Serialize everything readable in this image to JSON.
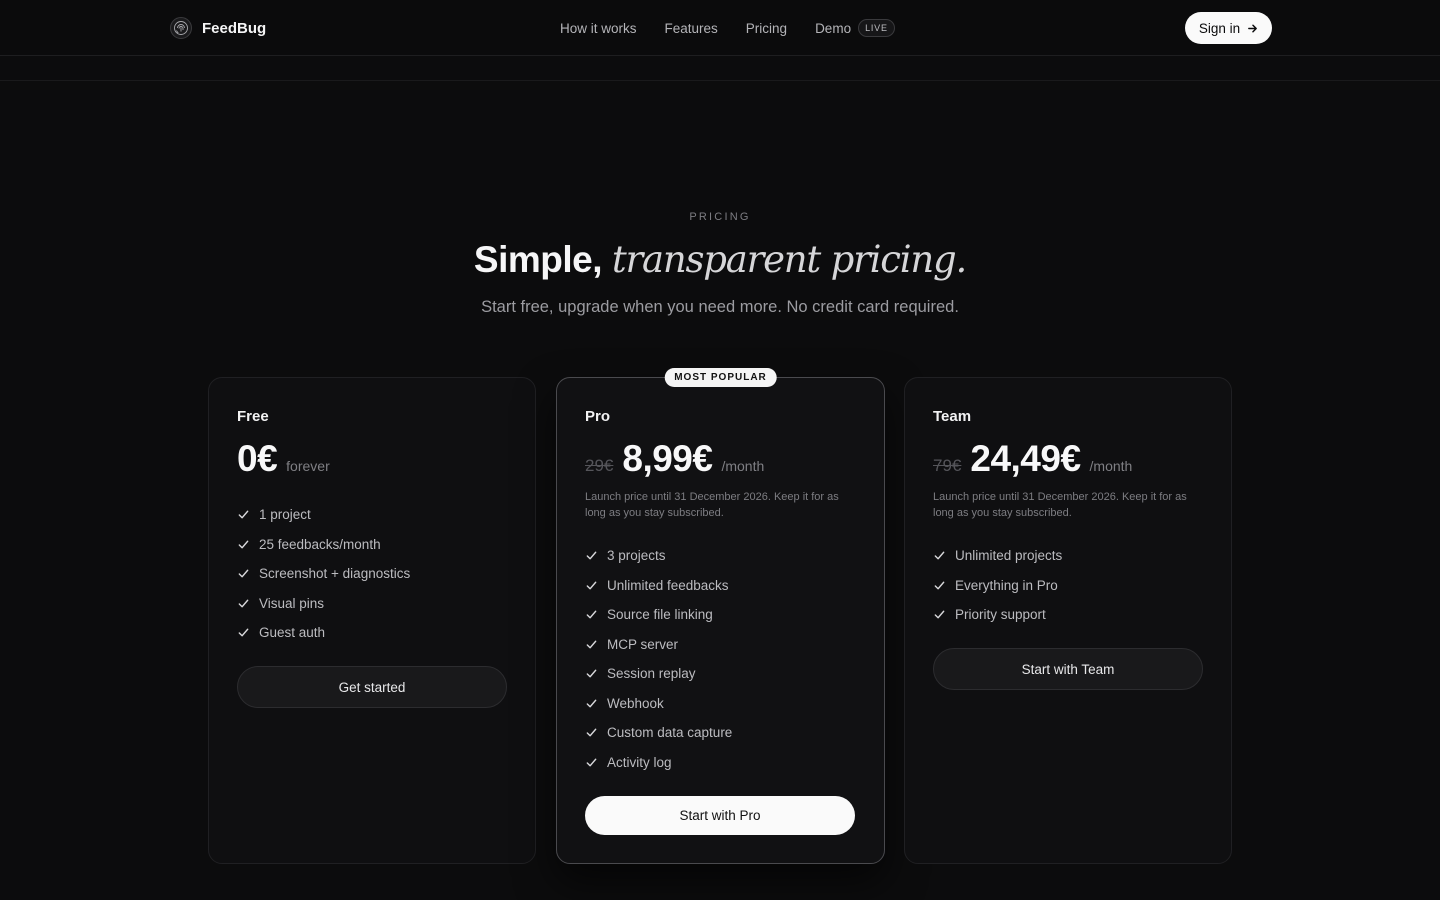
{
  "nav": {
    "brand": "FeedBug",
    "links": [
      "How it works",
      "Features",
      "Pricing",
      "Demo"
    ],
    "live_badge": "LIVE",
    "signin": "Sign in"
  },
  "hero": {
    "eyebrow": "PRICING",
    "title_plain": "Simple,",
    "title_italic": "transparent pricing.",
    "subtitle": "Start free, upgrade when you need more. No credit card required."
  },
  "plans": {
    "free": {
      "name": "Free",
      "price": "0€",
      "period": "forever",
      "features": [
        "1 project",
        "25 feedbacks/month",
        "Screenshot + diagnostics",
        "Visual pins",
        "Guest auth"
      ],
      "cta": "Get started"
    },
    "pro": {
      "badge": "MOST POPULAR",
      "name": "Pro",
      "old_price": "29€",
      "price": "8,99€",
      "period": "/month",
      "note": "Launch price until 31 December 2026. Keep it for as long as you stay subscribed.",
      "features": [
        "3 projects",
        "Unlimited feedbacks",
        "Source file linking",
        "MCP server",
        "Session replay",
        "Webhook",
        "Custom data capture",
        "Activity log"
      ],
      "cta": "Start with Pro"
    },
    "team": {
      "name": "Team",
      "old_price": "79€",
      "price": "24,49€",
      "period": "/month",
      "note": "Launch price until 31 December 2026. Keep it for as long as you stay subscribed.",
      "features": [
        "Unlimited projects",
        "Everything in Pro",
        "Priority support"
      ],
      "cta": "Start with Team"
    }
  },
  "icons": {
    "logo": "fingerprint-logo-icon",
    "arrow": "arrow-right-icon",
    "check": "check-icon"
  }
}
